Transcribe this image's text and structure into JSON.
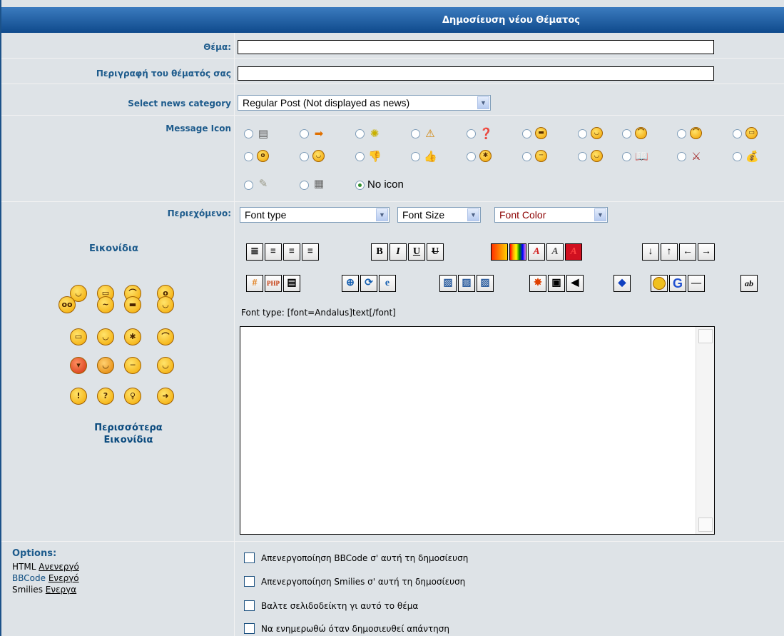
{
  "header": {
    "title": "Δημοσίευση νέου Θέματος"
  },
  "form": {
    "subject_label": "Θέμα:",
    "description_label": "Περιγραφή του θέματός σας",
    "category_label": "Select news category",
    "category_value": "Regular Post (Not displayed as news)",
    "message_icon_label": "Message Icon",
    "no_icon_label": "No icon",
    "content_label": "Περιεχόμενο:",
    "font_type": "Font type",
    "font_size": "Font Size",
    "font_color": "Font Color",
    "font_hint": "Font type: [font=Andalus]text[/font]"
  },
  "smilies": {
    "title": "Εικονίδια",
    "more_line1": "Περισσότερα",
    "more_line2": "Εικονίδια"
  },
  "options": {
    "title": "Options:",
    "html_label": "HTML",
    "html_state": "Ανενεργό",
    "bbcode_label": "BBCode",
    "bbcode_state": "Ενεργό",
    "smilies_label": "Smilies",
    "smilies_state": "Ενεργα",
    "checkboxes": [
      "Απενεργοποίηση BBCode σ' αυτή τη δημοσίευση",
      "Απενεργοποίηση Smilies σ' αυτή τη δημοσίευση",
      "Βαλτε σελιδοδείκτη γι αυτό το θέμα",
      "Να ενημερωθώ όταν δημοσιευθεί απάντηση"
    ]
  },
  "toolbar_icons": {
    "row1": [
      "align-justify-icon",
      "align-right-icon",
      "align-center-icon",
      "align-left-icon",
      "bold-icon",
      "italic-icon",
      "underline-icon",
      "strikethrough-icon",
      "gradient-icon",
      "rainbow-icon",
      "shadow-text-icon",
      "glow-text-icon",
      "highlight-text-icon",
      "arrow-down-icon",
      "arrow-up-icon",
      "arrow-left-icon",
      "arrow-right-icon"
    ],
    "row2": [
      "hash-icon",
      "php-icon",
      "code-icon",
      "web-link-icon",
      "refresh-link-icon",
      "ie-icon",
      "image-icon",
      "image-left-icon",
      "image-right-icon",
      "flash-icon",
      "video-icon",
      "sound-icon",
      "stream-icon",
      "smiley-icon",
      "google-icon",
      "horizontal-rule-icon",
      "text-style-icon"
    ]
  },
  "colors": {
    "header_bg": "#0f4a8c",
    "panel_bg": "#dee3e7",
    "label": "#1d5b8c"
  }
}
